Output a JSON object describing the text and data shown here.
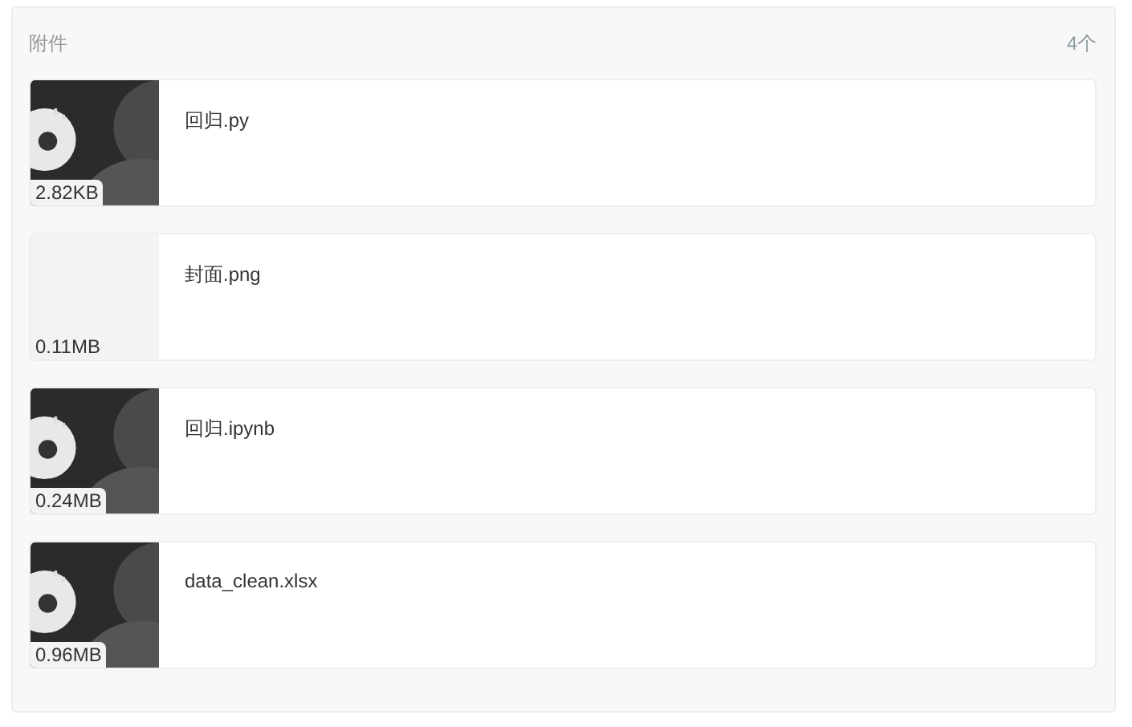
{
  "panel": {
    "title": "附件",
    "count": "4个"
  },
  "files": [
    {
      "name": "回归.py",
      "size": "2.82KB",
      "kind": "logo"
    },
    {
      "name": "封面.png",
      "size": "0.11MB",
      "kind": "blank"
    },
    {
      "name": "回归.ipynb",
      "size": "0.24MB",
      "kind": "logo"
    },
    {
      "name": "data_clean.xlsx",
      "size": "0.96MB",
      "kind": "logo"
    }
  ]
}
